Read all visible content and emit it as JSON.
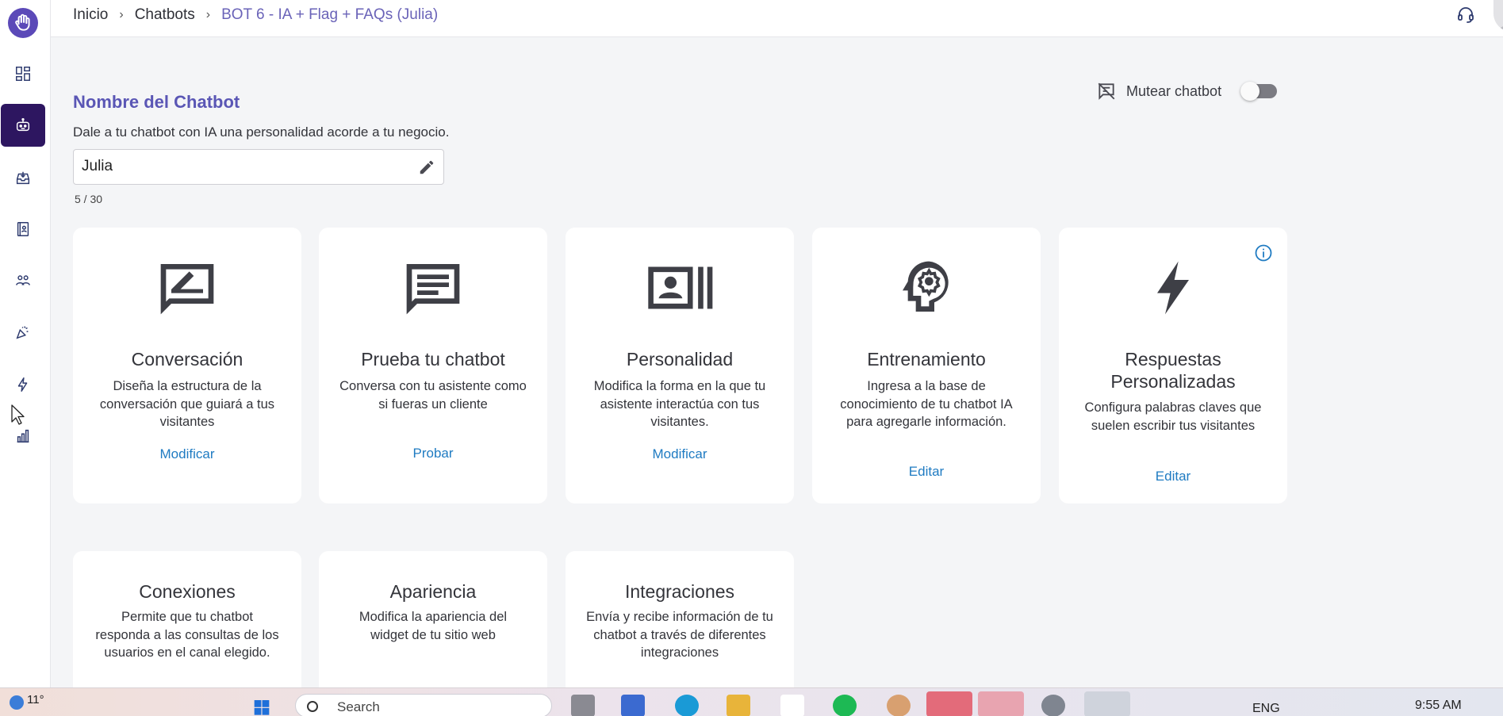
{
  "app": {
    "brand_color": "#5b49b8",
    "accent_dark": "#2d1660",
    "link_color": "#1f7bc2"
  },
  "sidebar": {
    "items": [
      {
        "name": "dashboard-icon",
        "active": false
      },
      {
        "name": "chatbot-icon",
        "active": true
      },
      {
        "name": "inbox-icon",
        "active": false
      },
      {
        "name": "contacts-book-icon",
        "active": false
      },
      {
        "name": "team-icon",
        "active": false
      },
      {
        "name": "campaign-icon",
        "active": false
      },
      {
        "name": "lightning-icon",
        "active": false
      },
      {
        "name": "analytics-icon",
        "active": false
      }
    ]
  },
  "breadcrumb": {
    "home": "Inicio",
    "section": "Chatbots",
    "current": "BOT 6 - IA + Flag + FAQs (Julia)"
  },
  "chatbot_name": {
    "title": "Nombre del Chatbot",
    "description": "Dale a tu chatbot con IA una personalidad acorde a tu negocio.",
    "value": "Julia",
    "char_count": "5 / 30"
  },
  "mute": {
    "label": "Mutear chatbot",
    "enabled": false
  },
  "cards": [
    {
      "title": "Conversación",
      "description": "Diseña la estructura de la conversación que guiará a tus visitantes",
      "action": "Modificar",
      "icon": "edit-chat-icon"
    },
    {
      "title": "Prueba tu chatbot",
      "description": "Conversa con tu asistente como si fueras un cliente",
      "action": "Probar",
      "icon": "chat-icon"
    },
    {
      "title": "Personalidad",
      "description": "Modifica la forma en la que tu asistente interactúa con tus visitantes.",
      "action": "Modificar",
      "icon": "profile-card-icon"
    },
    {
      "title": "Entrenamiento",
      "description": "Ingresa a la base de conocimiento de tu chatbot IA para agregarle información.",
      "action": "Editar",
      "icon": "brain-gear-icon"
    },
    {
      "title": "Respuestas Personalizadas",
      "description": "Configura palabras claves que suelen escribir tus visitantes",
      "action": "Editar",
      "icon": "lightning-icon"
    },
    {
      "title": "Conexiones",
      "description": "Permite que tu chatbot responda a las consultas de los usuarios en el canal elegido."
    },
    {
      "title": "Apariencia",
      "description": "Modifica la apariencia del widget de tu sitio web"
    },
    {
      "title": "Integraciones",
      "description": "Envía y recibe información de tu chatbot a través de diferentes integraciones"
    }
  ],
  "taskbar": {
    "weather": "11°",
    "search_placeholder": "Search",
    "language": "ENG",
    "time": "9:55 AM"
  }
}
